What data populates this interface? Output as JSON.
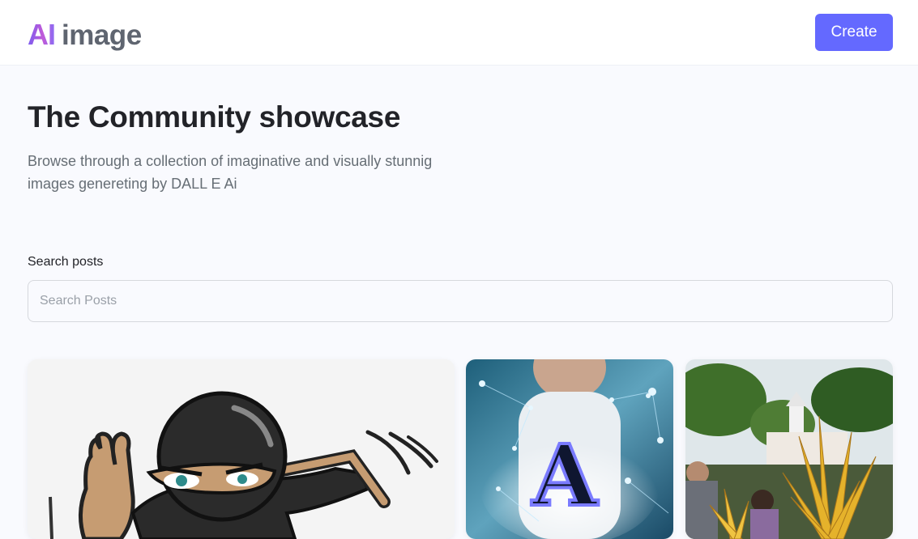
{
  "header": {
    "logo_mark": "AI",
    "logo_text": "image",
    "create_label": "Create"
  },
  "hero": {
    "title": "The Community showcase",
    "description_line1": "Browse through a collection of imaginative and visually stunnig",
    "description_line2": "images genereting by DALL E Ai"
  },
  "search": {
    "label": "Search posts",
    "placeholder": "Search Posts",
    "value": ""
  },
  "gallery": {
    "cards": [
      {
        "subject": "cartoon ninja"
      },
      {
        "subject": "glowing letter A"
      },
      {
        "subject": "golden plant in park"
      }
    ],
    "letter_glyph": "A"
  },
  "colors": {
    "accent": "#6469ff",
    "title": "#222328",
    "muted": "#666e75",
    "background": "#f9fafe"
  }
}
